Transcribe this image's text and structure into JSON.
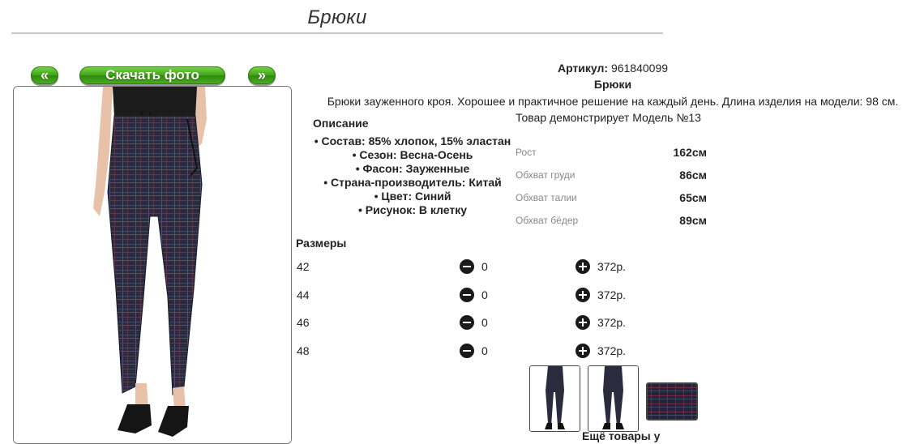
{
  "page": {
    "title": "Брюки"
  },
  "gallery": {
    "prev_label": "«",
    "download_label": "Скачать фото",
    "next_label": "»"
  },
  "product": {
    "article_label": "Артикул:",
    "article_value": "961840099",
    "name": "Брюки",
    "description": "Брюки зауженного кроя. Хорошее и практичное решение на каждый день. Длина изделия на модели: 98 см."
  },
  "specs": {
    "heading": "Описание",
    "items": [
      "Состав: 85% хлопок, 15% эластан",
      "Сезон: Весна-Осень",
      "Фасон: Зауженные",
      "Страна-производитель: Китай",
      "Цвет: Синий",
      "Рисунок: В клетку"
    ]
  },
  "model": {
    "note": "Товар демонстрирует Модель №13",
    "measurements": [
      {
        "label": "Рост",
        "value": "162см"
      },
      {
        "label": "Обхват груди",
        "value": "86см"
      },
      {
        "label": "Обхват талии",
        "value": "65см"
      },
      {
        "label": "Обхват бёдер",
        "value": "89см"
      }
    ]
  },
  "sizes": {
    "heading": "Размеры",
    "rows": [
      {
        "size": "42",
        "qty": "0",
        "price": "372р."
      },
      {
        "size": "44",
        "qty": "0",
        "price": "372р."
      },
      {
        "size": "46",
        "qty": "0",
        "price": "372р."
      },
      {
        "size": "48",
        "qty": "0",
        "price": "372р."
      }
    ]
  },
  "footer": {
    "more_label": "Ещё товары у"
  },
  "icons": {
    "prev": "chevron-left-double-icon",
    "next": "chevron-right-double-icon",
    "minus": "minus-circle-icon",
    "plus": "plus-circle-icon"
  },
  "colors": {
    "button_green": "#45a51b",
    "fabric_navy": "#2a2c3e",
    "accent_red": "#7a2a3a"
  }
}
